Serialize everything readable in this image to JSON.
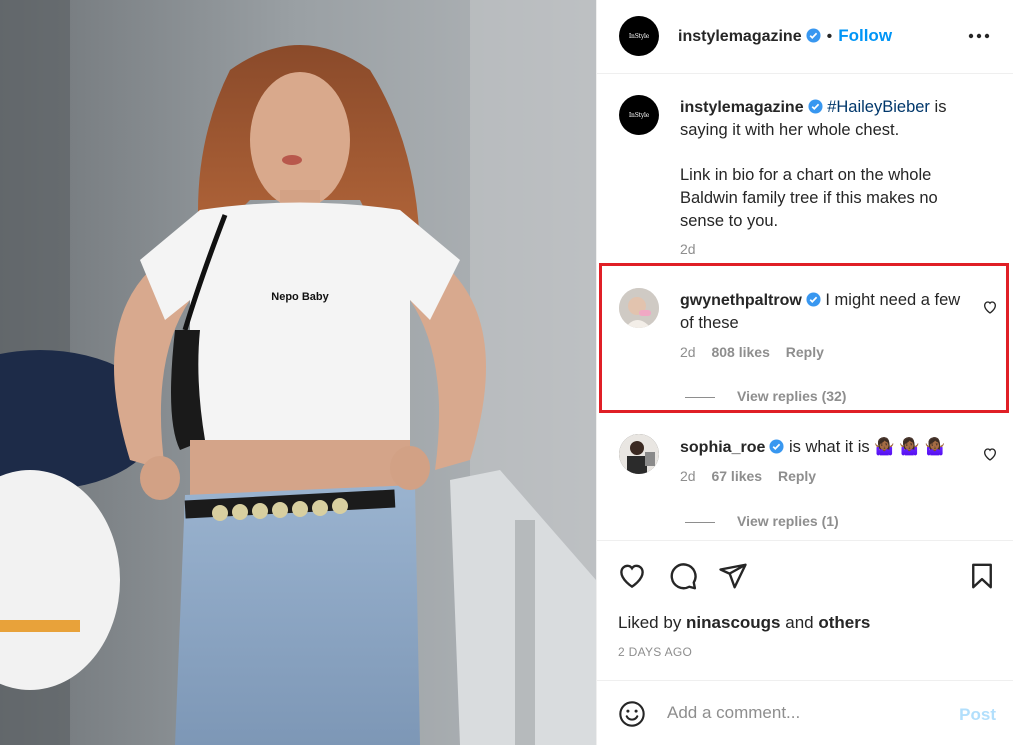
{
  "photo": {
    "shirt_text": "Nepo Baby"
  },
  "header": {
    "logo_text": "InStyle",
    "username": "instylemagazine",
    "follow_label": "Follow",
    "dot": "•"
  },
  "caption": {
    "username": "instylemagazine",
    "hashtag": "#HaileyBieber",
    "text_1": " is saying it with her whole chest.",
    "text_2": "Link in bio for a chart on the whole Baldwin family tree if this makes no sense to you.",
    "time": "2d"
  },
  "comments": [
    {
      "username": "gwynethpaltrow",
      "text": " I might need a few of these",
      "time": "2d",
      "likes": "808 likes",
      "reply_label": "Reply",
      "view_replies": "View replies (32)"
    },
    {
      "username": "sophia_roe",
      "text": " is what it is 🤷🏾‍♀️ 🤷🏾‍♀️ 🤷🏾‍♀️",
      "time": "2d",
      "likes": "67 likes",
      "reply_label": "Reply",
      "view_replies": "View replies (1)"
    }
  ],
  "likes": {
    "prefix": "Liked by ",
    "user": "ninascougs",
    "middle": " and ",
    "others": "others"
  },
  "post_date": "2 DAYS AGO",
  "add_comment": {
    "placeholder": "Add a comment...",
    "post_label": "Post"
  },
  "colors": {
    "accent": "#0095f6",
    "highlight": "#e01f26",
    "verified": "#3897f0"
  }
}
